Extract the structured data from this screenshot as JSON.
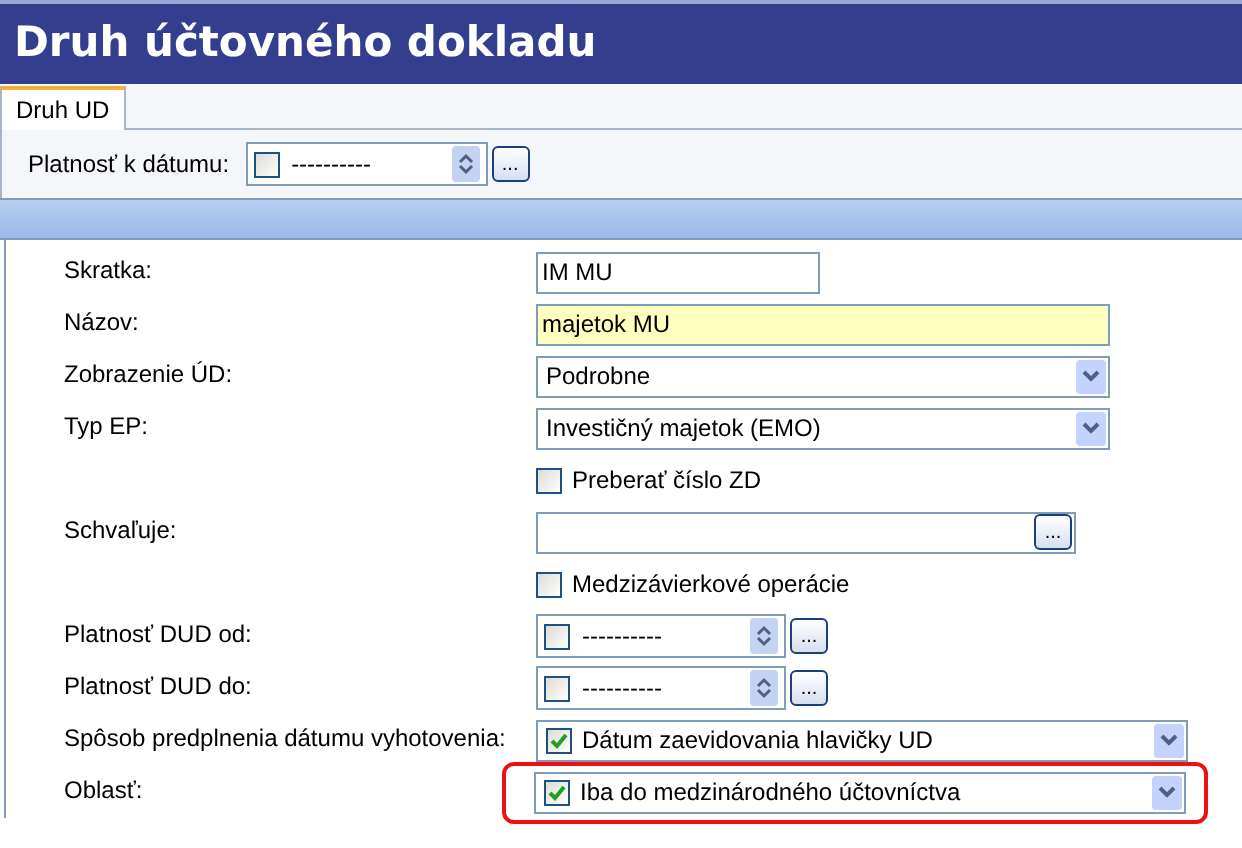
{
  "window": {
    "title": "Druh účtovného dokladu"
  },
  "tabs": [
    {
      "label": "Druh UD",
      "selected": true
    }
  ],
  "filter": {
    "label": "Platnosť k dátumu:",
    "checked": false,
    "value": "----------",
    "button_label": "..."
  },
  "fields": [
    {
      "kind": "short_text",
      "label": "Skratka:",
      "value": "IM MU"
    },
    {
      "kind": "long_text",
      "label": "Názov:",
      "value": "majetok MU",
      "required": true
    },
    {
      "kind": "select",
      "label": "Zobrazenie ÚD:",
      "value": "Podrobne"
    },
    {
      "kind": "select",
      "label": "Typ EP:",
      "value": "Investičný majetok (EMO)"
    },
    {
      "kind": "checkbox",
      "text": "Preberať číslo ZD",
      "checked": false
    },
    {
      "kind": "lookup",
      "label": "Schvaľuje:",
      "button_label": "..."
    },
    {
      "kind": "checkbox",
      "text": "Medzizávierkové operácie",
      "checked": false
    },
    {
      "kind": "date",
      "label": "Platnosť DUD od:",
      "checked": false,
      "value": "----------",
      "button_label": "..."
    },
    {
      "kind": "date",
      "label": "Platnosť DUD do:",
      "checked": false,
      "value": "----------",
      "button_label": "..."
    },
    {
      "kind": "checkselect",
      "label": "Spôsob predplnenia dátumu vyhotovenia:",
      "checked": true,
      "value": "Dátum zaevidovania hlavičky UD",
      "highlighted": false
    },
    {
      "kind": "checkselect",
      "label": "Oblasť:",
      "checked": true,
      "value": "Iba do medzinárodného účtovníctva",
      "highlighted": true
    }
  ]
}
